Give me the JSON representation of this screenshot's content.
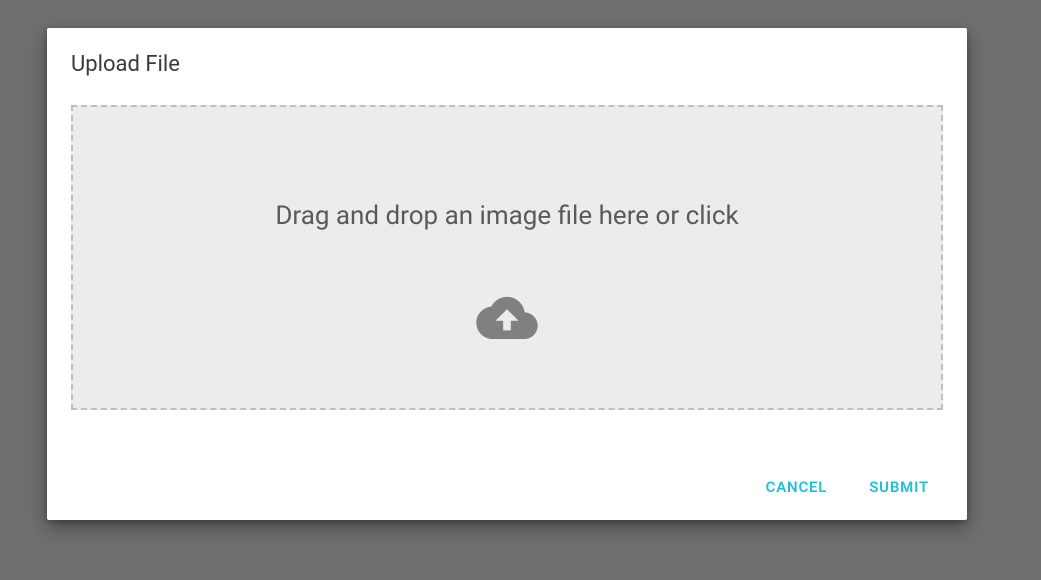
{
  "dialog": {
    "title": "Upload File",
    "dropzone_text": "Drag and drop an image file here or click",
    "actions": {
      "cancel_label": "CANCEL",
      "submit_label": "SUBMIT"
    }
  },
  "colors": {
    "accent": "#1fc0d4",
    "page_background": "#6f6f6f",
    "dialog_background": "#ffffff",
    "dropzone_background": "#ececec",
    "dropzone_border": "#bfbfbf",
    "icon_color": "#808080"
  }
}
